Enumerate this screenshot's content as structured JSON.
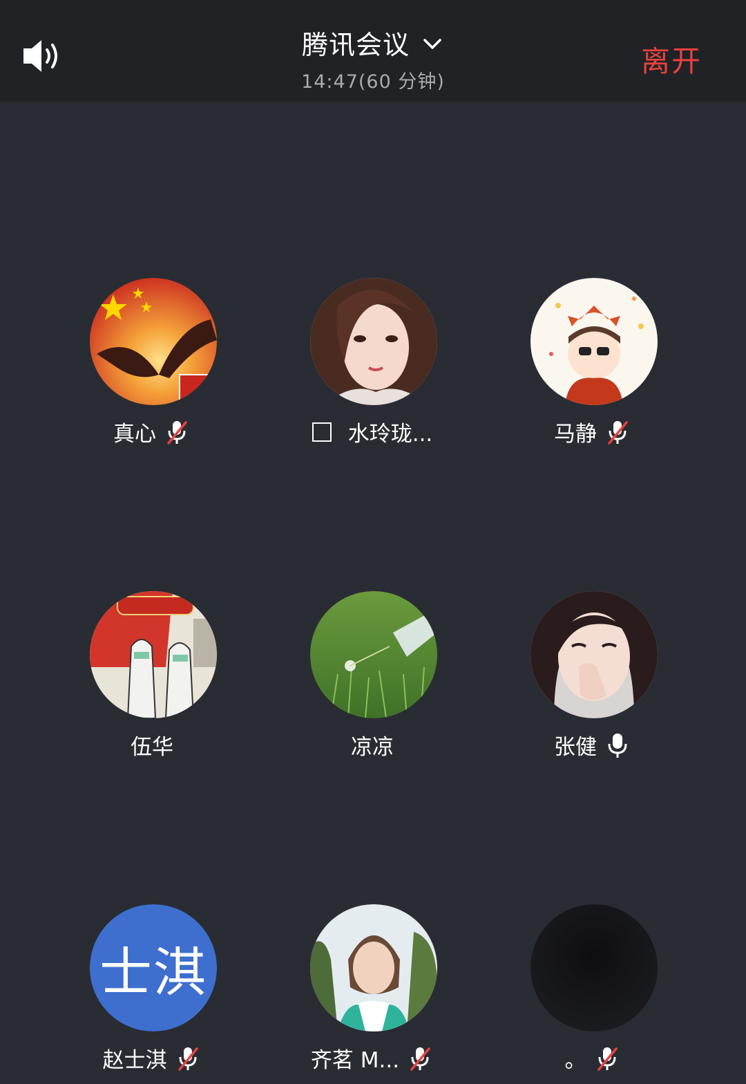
{
  "header": {
    "title": "腾讯会议",
    "subtitle": "14:47(60 分钟)",
    "leave_label": "离开"
  },
  "participants": [
    {
      "name": "真心",
      "mic": "muted",
      "avatar": "photo"
    },
    {
      "name": "水玲珑...",
      "mic": "none",
      "checkbox": true,
      "avatar": "photo"
    },
    {
      "name": "马静",
      "mic": "muted",
      "avatar": "photo"
    },
    {
      "name": "伍华",
      "mic": "none",
      "avatar": "photo"
    },
    {
      "name": "凉凉",
      "mic": "none",
      "avatar": "photo"
    },
    {
      "name": "张健",
      "mic": "active",
      "avatar": "photo"
    },
    {
      "name": "赵士淇",
      "mic": "muted",
      "avatar": "initials",
      "initials": "士淇"
    },
    {
      "name": "齐茗 M...",
      "mic": "muted",
      "avatar": "photo"
    },
    {
      "name": "。",
      "mic": "muted",
      "avatar": "photo"
    }
  ],
  "colors": {
    "background": "#2a2c33",
    "header": "#212226",
    "leave": "#e8423f",
    "initials_avatar": "#3e6fcf"
  }
}
